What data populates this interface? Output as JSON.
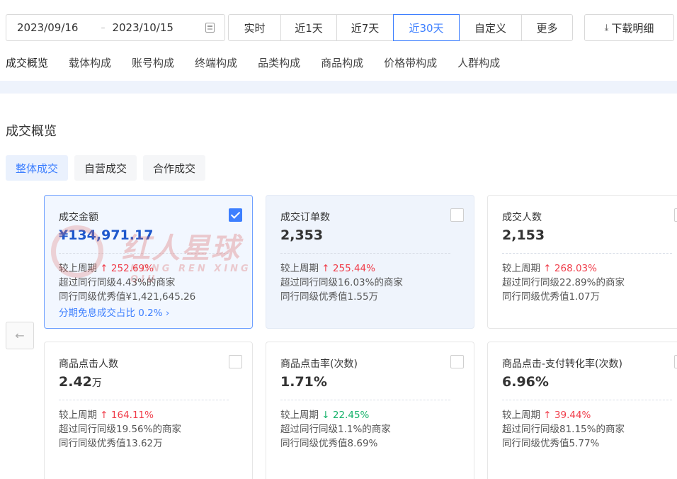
{
  "date_range": {
    "start": "2023/09/16",
    "separator": "–",
    "end": "2023/10/15"
  },
  "range_buttons": [
    {
      "label": "实时"
    },
    {
      "label": "近1天"
    },
    {
      "label": "近7天"
    },
    {
      "label": "近30天",
      "active": true
    },
    {
      "label": "自定义"
    },
    {
      "label": "更多"
    }
  ],
  "download": {
    "label": "下载明细"
  },
  "sub_tabs": [
    "成交概览",
    "载体构成",
    "账号构成",
    "终端构成",
    "品类构成",
    "商品构成",
    "价格带构成",
    "人群构成"
  ],
  "section_title": "成交概览",
  "panel_tabs": [
    "整体成交",
    "自营成交",
    "合作成交"
  ],
  "cards": [
    {
      "label": "成交金额",
      "value": "¥134,971.17",
      "unit": "",
      "compare_label": "较上周期",
      "change": "252.69%",
      "trend": "up",
      "rank_text": "超过同行同级4.43%的商家",
      "excellent_text": "同行同级优秀值¥1,421,645.26",
      "link_text": "分期免息成交占比 0.2% ›",
      "checked": true
    },
    {
      "label": "成交订单数",
      "value": "2,353",
      "unit": "",
      "compare_label": "较上周期",
      "change": "255.44%",
      "trend": "up",
      "rank_text": "超过同行同级16.03%的商家",
      "excellent_text": "同行同级优秀值1.55万",
      "checked": false
    },
    {
      "label": "成交人数",
      "value": "2,153",
      "unit": "",
      "compare_label": "较上周期",
      "change": "268.03%",
      "trend": "up",
      "rank_text": "超过同行同级22.89%的商家",
      "excellent_text": "同行同级优秀值1.07万",
      "checked": false
    },
    {
      "label": "商品点击人数",
      "value": "2.42",
      "unit": "万",
      "compare_label": "较上周期",
      "change": "164.11%",
      "trend": "up",
      "rank_text": "超过同行同级19.56%的商家",
      "excellent_text": "同行同级优秀值13.62万",
      "checked": false
    },
    {
      "label": "商品点击率(次数)",
      "value": "1.71%",
      "unit": "",
      "compare_label": "较上周期",
      "change": "22.45%",
      "trend": "down",
      "rank_text": "超过同行同级1.1%的商家",
      "excellent_text": "同行同级优秀值8.69%",
      "checked": false
    },
    {
      "label": "商品点击-支付转化率(次数)",
      "value": "6.96%",
      "unit": "",
      "compare_label": "较上周期",
      "change": "39.44%",
      "trend": "up",
      "rank_text": "超过同行同级81.15%的商家",
      "excellent_text": "同行同级优秀值5.77%",
      "checked": false
    }
  ],
  "watermark": {
    "text_cn": "红人星球",
    "text_en": "HONG REN XING QIU"
  },
  "icons": {
    "calendar": "calendar-icon",
    "download": "download-icon",
    "prev": "arrow-left-icon",
    "checkbox": "checkbox-icon",
    "trend_up": "arrow-up-icon",
    "trend_down": "arrow-down-icon"
  },
  "colors": {
    "accent": "#3d7fff",
    "up": "#f03d4a",
    "down": "#16b26a",
    "selected_bg": "#f2f7ff"
  }
}
